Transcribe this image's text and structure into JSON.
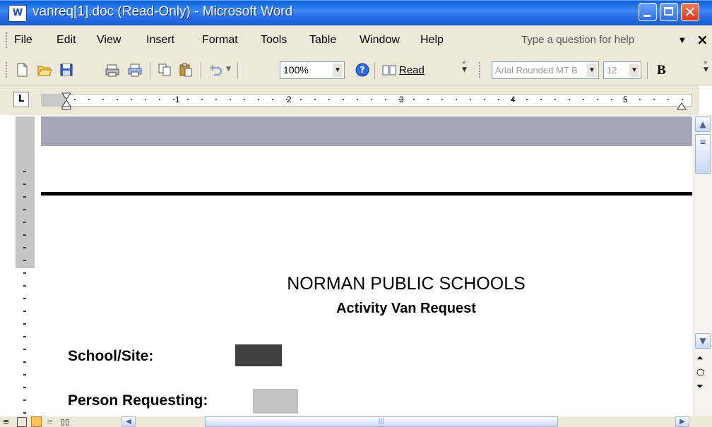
{
  "window": {
    "title": "vanreq[1].doc (Read-Only) - Microsoft Word",
    "app_icon_glyph": "W"
  },
  "menu": {
    "items": [
      "File",
      "Edit",
      "View",
      "Insert",
      "Format",
      "Tools",
      "Table",
      "Window",
      "Help"
    ],
    "help_placeholder": "Type a question for help",
    "close_glyph": "×"
  },
  "toolbar": {
    "zoom": "100%",
    "read_label": "Read",
    "font_name": "Arial Rounded MT B",
    "font_size": "12",
    "bold_label": "B"
  },
  "ruler": {
    "numbers": [
      "1",
      "2",
      "3",
      "4",
      "5"
    ],
    "tab_selector": "L"
  },
  "document": {
    "heading": "NORMAN PUBLIC SCHOOLS",
    "subheading": "Activity Van Request",
    "field1_label": "School/Site:",
    "field2_label": "Person Requesting:"
  },
  "colors": {
    "titlebar": "#2a6fe8",
    "chrome": "#ece9d8",
    "header_band": "#a7a7bc"
  }
}
